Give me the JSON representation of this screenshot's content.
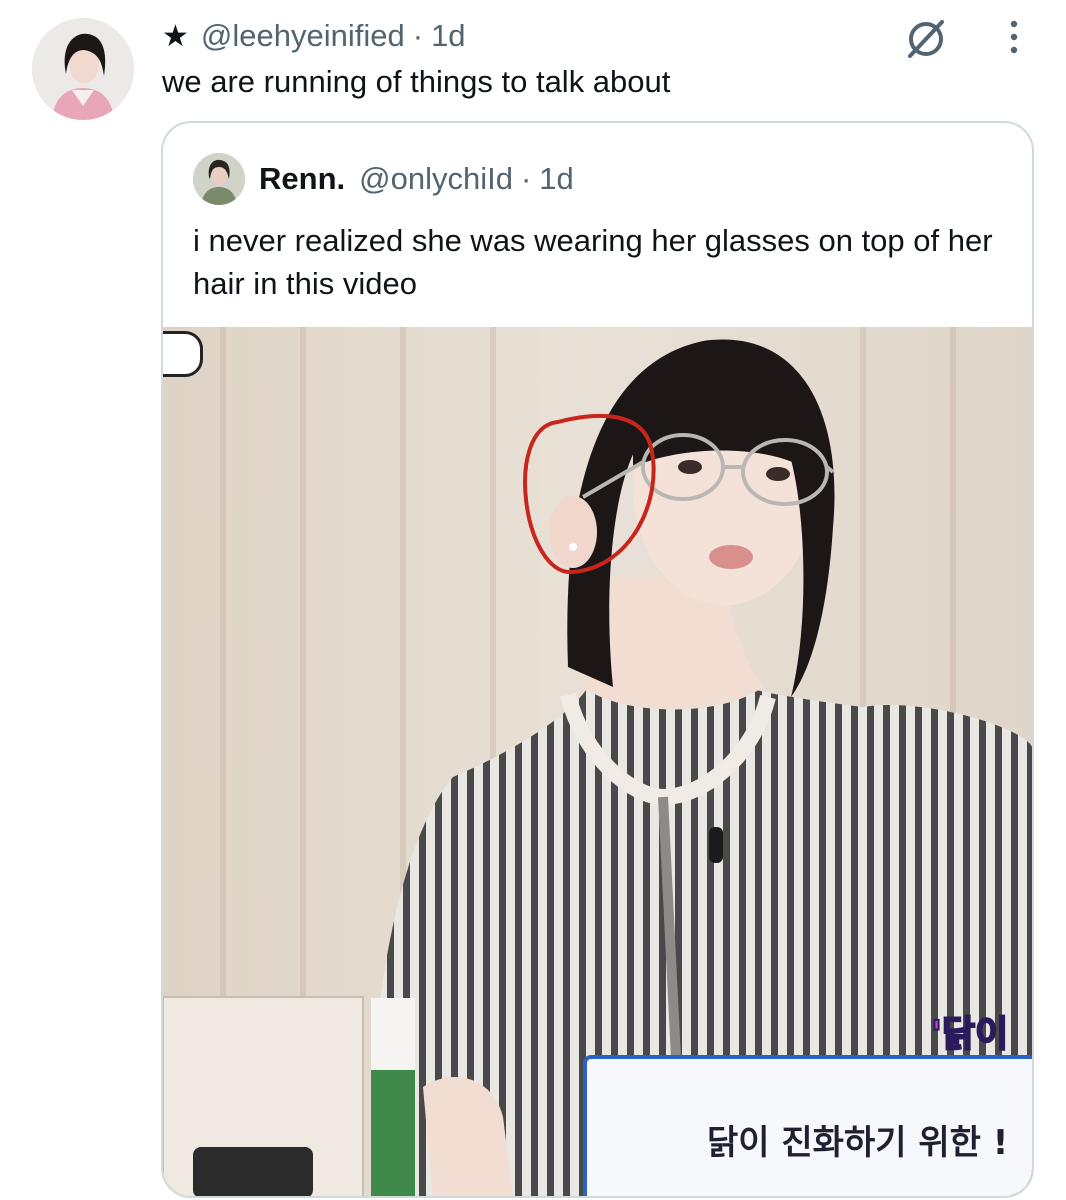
{
  "tweet": {
    "star": "★",
    "handle": "@leehyeinified",
    "separator": "·",
    "time": "1d",
    "text": "we are running of things to talk about",
    "icons": {
      "avatar": "profile-photo",
      "mute": "mute-icon",
      "more": "more-vertical-icon"
    }
  },
  "quote": {
    "name": "Renn.",
    "handle": "@onlychiId",
    "separator": "·",
    "time": "1d",
    "text": "i never realized she was wearing her glasses on top of her hair in this video",
    "media": {
      "badge": "'닭이",
      "caption": "닭이 진화하기 위한 !"
    }
  },
  "colors": {
    "border": "#cfd9de",
    "muted": "#536471",
    "text": "#0f1419",
    "circle": "#c8261c"
  }
}
